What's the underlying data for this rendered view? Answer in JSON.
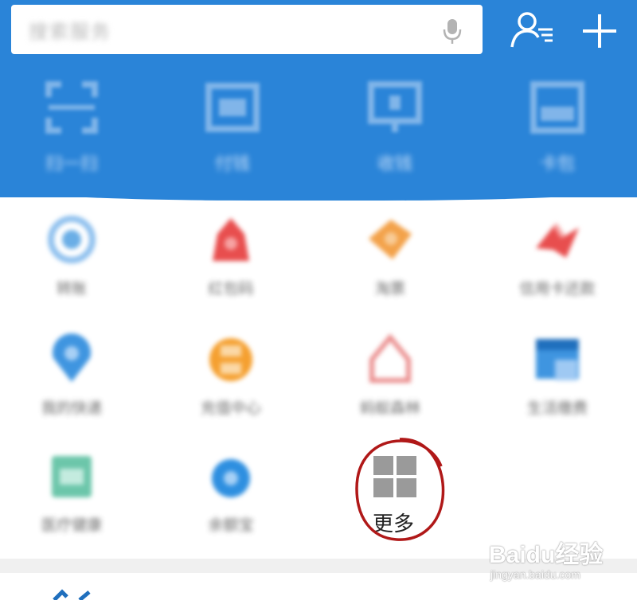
{
  "header": {
    "search": {
      "placeholder": "搜索服务"
    },
    "tools": [
      {
        "label": "扫一扫",
        "icon": "scan-icon"
      },
      {
        "label": "付钱",
        "icon": "pay-icon"
      },
      {
        "label": "收钱",
        "icon": "collect-icon"
      },
      {
        "label": "卡包",
        "icon": "card-icon"
      }
    ]
  },
  "grid": {
    "items": [
      {
        "label": "转账",
        "icon": "transfer-icon",
        "color": "#6aaee6"
      },
      {
        "label": "红包码",
        "icon": "red-envelope-icon",
        "color": "#e84e4e"
      },
      {
        "label": "淘票",
        "icon": "ticket-icon",
        "color": "#f3a24a"
      },
      {
        "label": "信用卡还款",
        "icon": "credit-card-icon",
        "color": "#e84e4e"
      },
      {
        "label": "我的快递",
        "icon": "location-icon",
        "color": "#3f95e0"
      },
      {
        "label": "充值中心",
        "icon": "recharge-icon",
        "color": "#f5a030"
      },
      {
        "label": "蚂蚁森林",
        "icon": "forest-icon",
        "color": "#ea8d8d"
      },
      {
        "label": "生活缴费",
        "icon": "bill-icon",
        "color": "#3f95e0"
      },
      {
        "label": "医疗健康",
        "icon": "health-icon",
        "color": "#6cc6aa"
      },
      {
        "label": "余额宝",
        "icon": "wallet-icon",
        "color": "#2e8fe0"
      }
    ],
    "more": {
      "label": "更多",
      "icon": "more-grid-icon"
    }
  },
  "watermark": {
    "brand": "Baidu经验",
    "url": "jingyan.baidu.com"
  },
  "colors": {
    "header_bg": "#2a84d8",
    "annotation_red": "#b01818"
  }
}
